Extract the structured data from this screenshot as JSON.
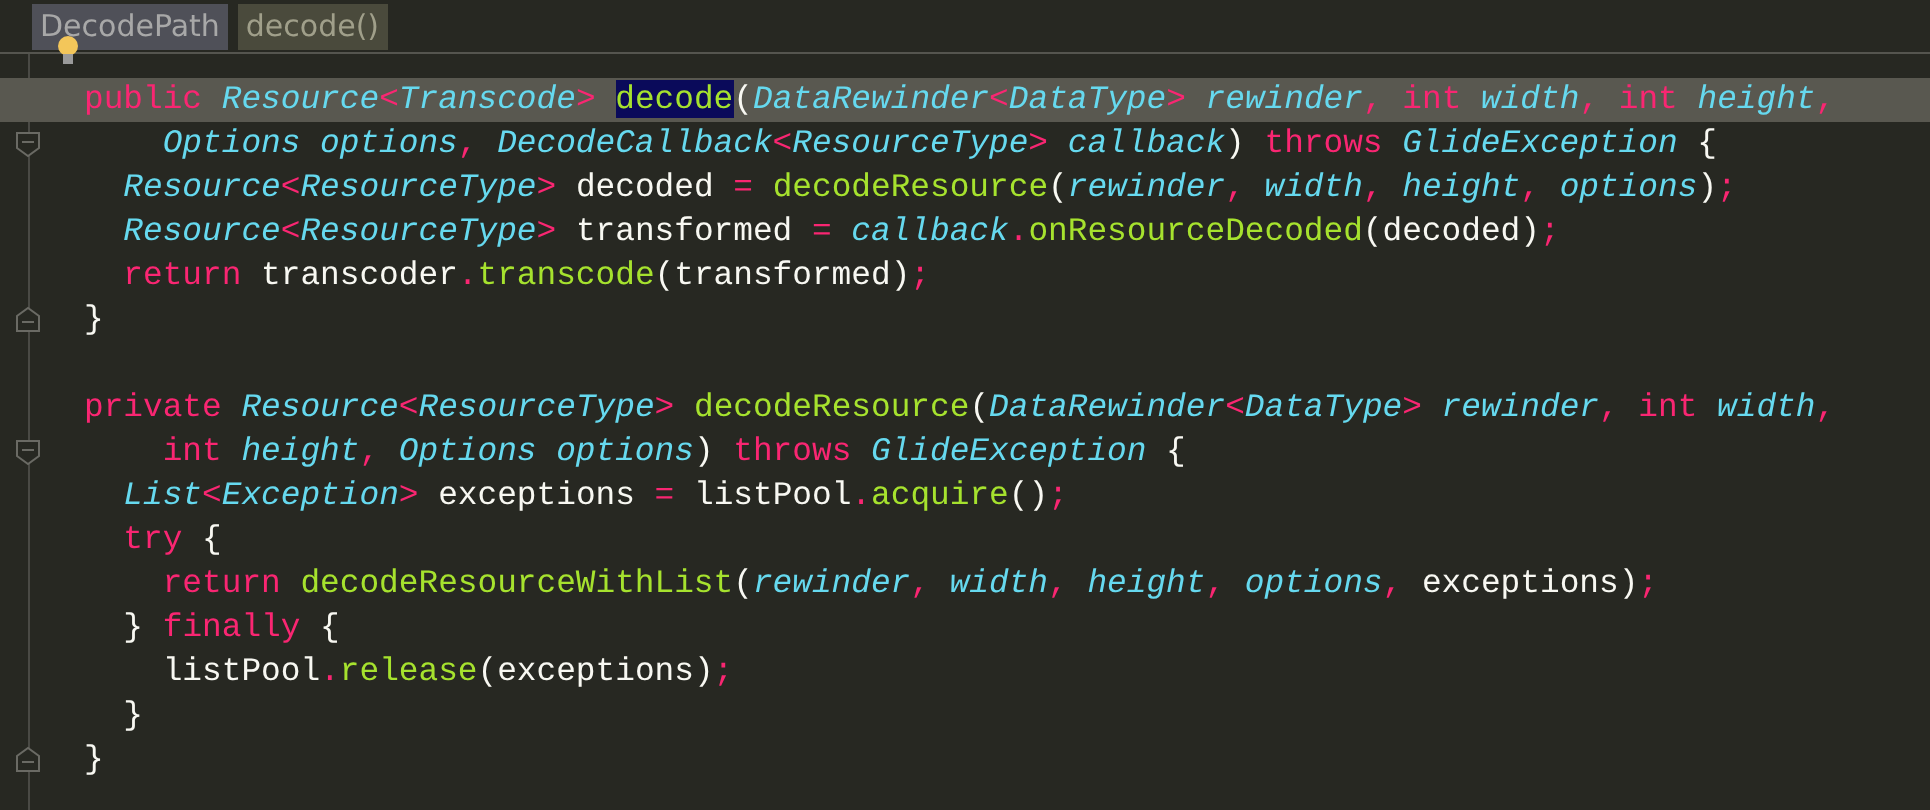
{
  "breadcrumbs": [
    {
      "label": "DecodePath",
      "selected": false
    },
    {
      "label": "decode()",
      "selected": true
    }
  ],
  "editor": {
    "lines": [
      {
        "kind": "code",
        "current": true,
        "tokens": [
          {
            "kind": "kw",
            "text": "public "
          },
          {
            "kind": "type",
            "text": "Resource"
          },
          {
            "kind": "op",
            "text": "<"
          },
          {
            "kind": "type",
            "text": "Transcode"
          },
          {
            "kind": "op",
            "text": "> "
          },
          {
            "kind": "match",
            "text": "decode"
          },
          {
            "kind": "plain",
            "text": "("
          },
          {
            "kind": "type",
            "text": "DataRewinder"
          },
          {
            "kind": "op",
            "text": "<"
          },
          {
            "kind": "type",
            "text": "DataType"
          },
          {
            "kind": "op",
            "text": ">"
          },
          {
            "kind": "param",
            "text": " rewinder"
          },
          {
            "kind": "op",
            "text": ","
          },
          {
            "kind": "kw",
            "text": " int"
          },
          {
            "kind": "param",
            "text": " width"
          },
          {
            "kind": "op",
            "text": ","
          },
          {
            "kind": "kw",
            "text": " int"
          },
          {
            "kind": "param",
            "text": " height"
          },
          {
            "kind": "op",
            "text": ","
          }
        ]
      },
      {
        "kind": "foldstart",
        "current": false,
        "tokens": [
          {
            "kind": "type",
            "text": "    Options options"
          },
          {
            "kind": "op",
            "text": ","
          },
          {
            "kind": "type",
            "text": " DecodeCallback"
          },
          {
            "kind": "op",
            "text": "<"
          },
          {
            "kind": "type",
            "text": "ResourceType"
          },
          {
            "kind": "op",
            "text": ">"
          },
          {
            "kind": "param",
            "text": " callback"
          },
          {
            "kind": "plain",
            "text": ")"
          },
          {
            "kind": "kw",
            "text": " throws"
          },
          {
            "kind": "type",
            "text": " GlideException"
          },
          {
            "kind": "plain",
            "text": " {"
          }
        ]
      },
      {
        "kind": "code",
        "current": false,
        "tokens": [
          {
            "kind": "type",
            "text": "  Resource"
          },
          {
            "kind": "op",
            "text": "<"
          },
          {
            "kind": "type",
            "text": "ResourceType"
          },
          {
            "kind": "op",
            "text": ">"
          },
          {
            "kind": "plain",
            "text": " decoded "
          },
          {
            "kind": "op",
            "text": "="
          },
          {
            "kind": "fn",
            "text": " decodeResource"
          },
          {
            "kind": "plain",
            "text": "("
          },
          {
            "kind": "param",
            "text": "rewinder"
          },
          {
            "kind": "op",
            "text": ","
          },
          {
            "kind": "param",
            "text": " width"
          },
          {
            "kind": "op",
            "text": ","
          },
          {
            "kind": "param",
            "text": " height"
          },
          {
            "kind": "op",
            "text": ","
          },
          {
            "kind": "param",
            "text": " options"
          },
          {
            "kind": "plain",
            "text": ")"
          },
          {
            "kind": "op",
            "text": ";"
          }
        ]
      },
      {
        "kind": "code",
        "current": false,
        "tokens": [
          {
            "kind": "type",
            "text": "  Resource"
          },
          {
            "kind": "op",
            "text": "<"
          },
          {
            "kind": "type",
            "text": "ResourceType"
          },
          {
            "kind": "op",
            "text": ">"
          },
          {
            "kind": "plain",
            "text": " transformed "
          },
          {
            "kind": "op",
            "text": "="
          },
          {
            "kind": "param",
            "text": " callback"
          },
          {
            "kind": "op",
            "text": "."
          },
          {
            "kind": "fn",
            "text": "onResourceDecoded"
          },
          {
            "kind": "plain",
            "text": "(decoded)"
          },
          {
            "kind": "op",
            "text": ";"
          }
        ]
      },
      {
        "kind": "code",
        "current": false,
        "tokens": [
          {
            "kind": "kw",
            "text": "  return"
          },
          {
            "kind": "plain",
            "text": " transcoder"
          },
          {
            "kind": "op",
            "text": "."
          },
          {
            "kind": "fn",
            "text": "transcode"
          },
          {
            "kind": "plain",
            "text": "(transformed)"
          },
          {
            "kind": "op",
            "text": ";"
          }
        ]
      },
      {
        "kind": "foldend",
        "current": false,
        "tokens": [
          {
            "kind": "plain",
            "text": "}"
          }
        ]
      },
      {
        "kind": "blank"
      },
      {
        "kind": "code",
        "current": false,
        "tokens": [
          {
            "kind": "kw",
            "text": "private "
          },
          {
            "kind": "type",
            "text": "Resource"
          },
          {
            "kind": "op",
            "text": "<"
          },
          {
            "kind": "type",
            "text": "ResourceType"
          },
          {
            "kind": "op",
            "text": ">"
          },
          {
            "kind": "fn",
            "text": " decodeResource"
          },
          {
            "kind": "plain",
            "text": "("
          },
          {
            "kind": "type",
            "text": "DataRewinder"
          },
          {
            "kind": "op",
            "text": "<"
          },
          {
            "kind": "type",
            "text": "DataType"
          },
          {
            "kind": "op",
            "text": ">"
          },
          {
            "kind": "param",
            "text": " rewinder"
          },
          {
            "kind": "op",
            "text": ","
          },
          {
            "kind": "kw",
            "text": " int"
          },
          {
            "kind": "param",
            "text": " width"
          },
          {
            "kind": "op",
            "text": ","
          }
        ]
      },
      {
        "kind": "foldstart",
        "current": false,
        "tokens": [
          {
            "kind": "kw",
            "text": "    int"
          },
          {
            "kind": "param",
            "text": " height"
          },
          {
            "kind": "op",
            "text": ","
          },
          {
            "kind": "type",
            "text": " Options options"
          },
          {
            "kind": "plain",
            "text": ")"
          },
          {
            "kind": "kw",
            "text": " throws"
          },
          {
            "kind": "type",
            "text": " GlideException"
          },
          {
            "kind": "plain",
            "text": " {"
          }
        ]
      },
      {
        "kind": "code",
        "current": false,
        "tokens": [
          {
            "kind": "type",
            "text": "  List"
          },
          {
            "kind": "op",
            "text": "<"
          },
          {
            "kind": "type",
            "text": "Exception"
          },
          {
            "kind": "op",
            "text": ">"
          },
          {
            "kind": "plain",
            "text": " exceptions "
          },
          {
            "kind": "op",
            "text": "="
          },
          {
            "kind": "plain",
            "text": " listPool"
          },
          {
            "kind": "op",
            "text": "."
          },
          {
            "kind": "fn",
            "text": "acquire"
          },
          {
            "kind": "plain",
            "text": "()"
          },
          {
            "kind": "op",
            "text": ";"
          }
        ]
      },
      {
        "kind": "code",
        "current": false,
        "tokens": [
          {
            "kind": "kw",
            "text": "  try"
          },
          {
            "kind": "plain",
            "text": " {"
          }
        ]
      },
      {
        "kind": "code",
        "current": false,
        "tokens": [
          {
            "kind": "kw",
            "text": "    return"
          },
          {
            "kind": "fn",
            "text": " decodeResourceWithList"
          },
          {
            "kind": "plain",
            "text": "("
          },
          {
            "kind": "param",
            "text": "rewinder"
          },
          {
            "kind": "op",
            "text": ","
          },
          {
            "kind": "param",
            "text": " width"
          },
          {
            "kind": "op",
            "text": ","
          },
          {
            "kind": "param",
            "text": " height"
          },
          {
            "kind": "op",
            "text": ","
          },
          {
            "kind": "param",
            "text": " options"
          },
          {
            "kind": "op",
            "text": ","
          },
          {
            "kind": "plain",
            "text": " exceptions)"
          },
          {
            "kind": "op",
            "text": ";"
          }
        ]
      },
      {
        "kind": "code",
        "current": false,
        "tokens": [
          {
            "kind": "plain",
            "text": "  }"
          },
          {
            "kind": "kw",
            "text": " finally"
          },
          {
            "kind": "plain",
            "text": " {"
          }
        ]
      },
      {
        "kind": "code",
        "current": false,
        "tokens": [
          {
            "kind": "plain",
            "text": "    listPool"
          },
          {
            "kind": "op",
            "text": "."
          },
          {
            "kind": "fn",
            "text": "release"
          },
          {
            "kind": "plain",
            "text": "(exceptions)"
          },
          {
            "kind": "op",
            "text": ";"
          }
        ]
      },
      {
        "kind": "code",
        "current": false,
        "tokens": [
          {
            "kind": "plain",
            "text": "  }"
          }
        ]
      },
      {
        "kind": "foldend",
        "current": false,
        "tokens": [
          {
            "kind": "plain",
            "text": "}"
          }
        ]
      }
    ]
  }
}
